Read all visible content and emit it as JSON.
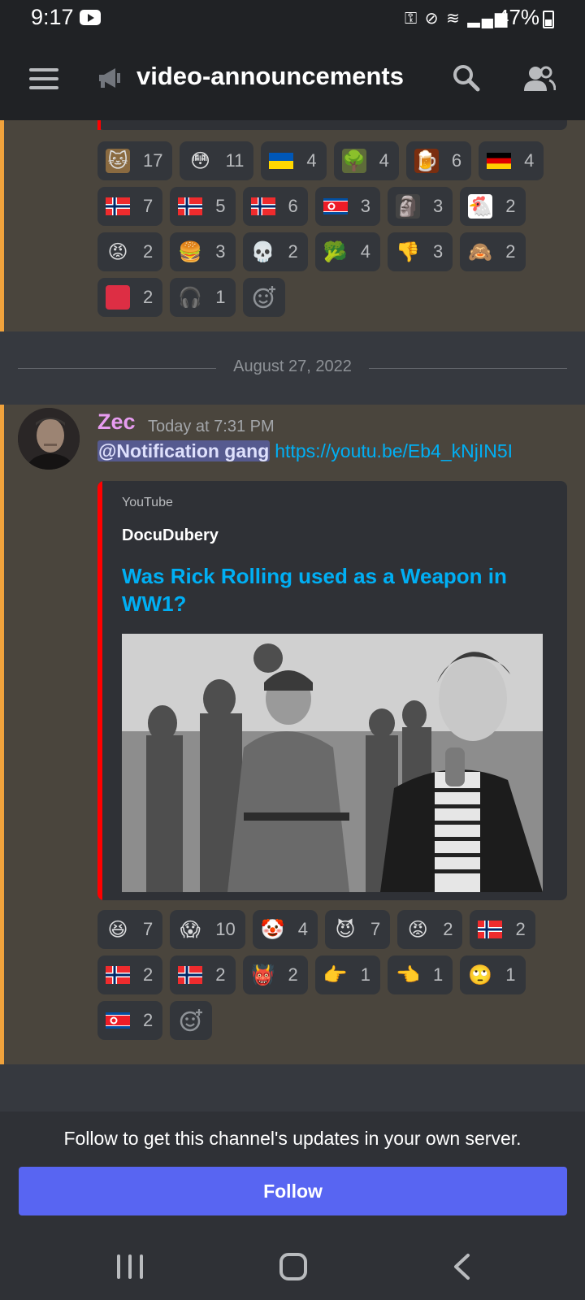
{
  "status_bar": {
    "time": "9:17",
    "battery": "47%"
  },
  "header": {
    "channel_name": "video-announcements",
    "icons": [
      "hamburger-menu-icon",
      "megaphone-icon",
      "search-icon",
      "members-icon"
    ]
  },
  "top_reactions": [
    {
      "emoji": "cat-meme",
      "count": "17"
    },
    {
      "emoji": "flushed-face",
      "count": "11"
    },
    {
      "emoji": "flag-ukraine",
      "count": "4"
    },
    {
      "emoji": "shrek-meme",
      "count": "4"
    },
    {
      "emoji": "mug-root-beer",
      "count": "6"
    },
    {
      "emoji": "flag-germany",
      "count": "4"
    },
    {
      "emoji": "flag-norway",
      "count": "7"
    },
    {
      "emoji": "flag-norway",
      "count": "5"
    },
    {
      "emoji": "flag-norway",
      "count": "6"
    },
    {
      "emoji": "flag-north-korea",
      "count": "3"
    },
    {
      "emoji": "statue",
      "count": "3"
    },
    {
      "emoji": "kfc-colonel",
      "count": "2"
    },
    {
      "emoji": "pink-face",
      "count": "2"
    },
    {
      "emoji": "burger",
      "count": "3"
    },
    {
      "emoji": "skull",
      "count": "2"
    },
    {
      "emoji": "broccoli",
      "count": "4"
    },
    {
      "emoji": "thumbs-down",
      "count": "3"
    },
    {
      "emoji": "see-no-evil-monkey",
      "count": "2"
    },
    {
      "emoji": "red-square",
      "count": "2"
    },
    {
      "emoji": "headphones-music",
      "count": "1"
    }
  ],
  "date_divider": "August 27, 2022",
  "message": {
    "author": "Zec",
    "timestamp": "Today at 7:31 PM",
    "mention": "@Notification gang",
    "link": "https://youtu.be/Eb4_kNjIN5I",
    "embed": {
      "provider": "YouTube",
      "author": "DocuDubery",
      "title": "Was Rick Rolling used as a Weapon in WW1?"
    },
    "reactions": [
      {
        "emoji": "laughing-face",
        "count": "7"
      },
      {
        "emoji": "screaming-face",
        "count": "10"
      },
      {
        "emoji": "clown-face",
        "count": "4"
      },
      {
        "emoji": "trollface",
        "count": "7"
      },
      {
        "emoji": "pink-face",
        "count": "2"
      },
      {
        "emoji": "flag-norway",
        "count": "2"
      },
      {
        "emoji": "flag-norway",
        "count": "2"
      },
      {
        "emoji": "flag-norway",
        "count": "2"
      },
      {
        "emoji": "trollface-dark",
        "count": "2"
      },
      {
        "emoji": "point-right",
        "count": "1"
      },
      {
        "emoji": "point-left",
        "count": "1"
      },
      {
        "emoji": "rolling-eyes",
        "count": "1"
      },
      {
        "emoji": "flag-north-korea",
        "count": "2"
      }
    ]
  },
  "follow": {
    "text": "Follow to get this channel's updates in your own server.",
    "button_label": "Follow"
  },
  "colors": {
    "accent_orange": "#f0a23c",
    "blurple": "#5865f2",
    "link_blue": "#00aff4",
    "author_pink": "#e79cf0",
    "embed_bar_red": "#ff0000"
  }
}
